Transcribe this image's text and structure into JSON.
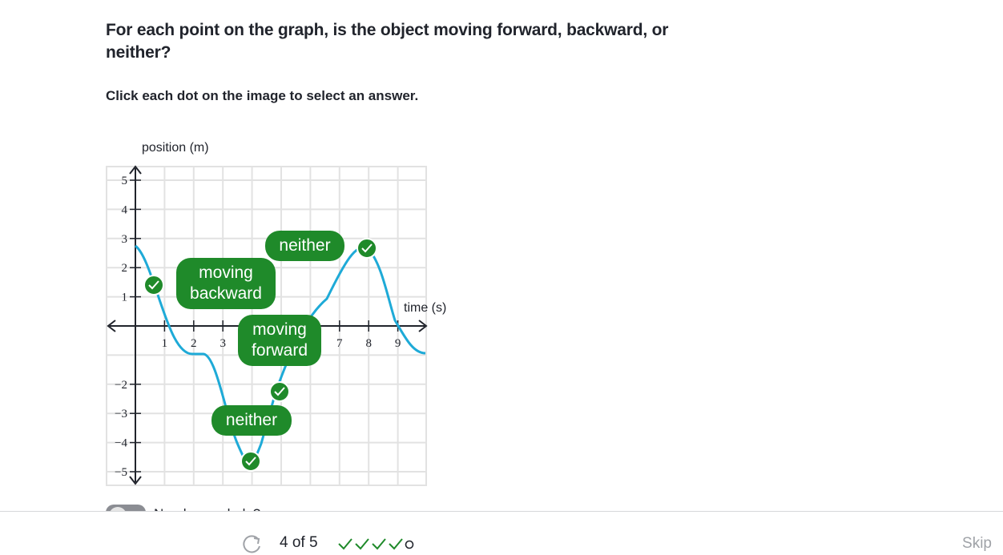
{
  "question": "For each point on the graph, is the object moving forward, backward, or neither?",
  "instruction": "Click each dot on the image to select an answer.",
  "graph": {
    "y_axis_label": "position (m)",
    "x_axis_label": "time (s)",
    "x_ticks": [
      "1",
      "2",
      "3",
      "7",
      "8",
      "9"
    ],
    "y_ticks": [
      "5",
      "4",
      "3",
      "2",
      "1",
      "−2",
      "−3",
      "−4",
      "−5"
    ],
    "curve_color": "#1eaad7",
    "point_color": "#1f8a2a"
  },
  "answer_labels": {
    "moving_backward": "moving\nbackward",
    "neither_top": "neither",
    "moving_forward": "moving\nforward",
    "neither_bottom": "neither"
  },
  "hint_label": "Need some help?",
  "footer": {
    "progress": "4 of 5",
    "completed": 4,
    "total": 5,
    "skip_label": "Skip"
  }
}
